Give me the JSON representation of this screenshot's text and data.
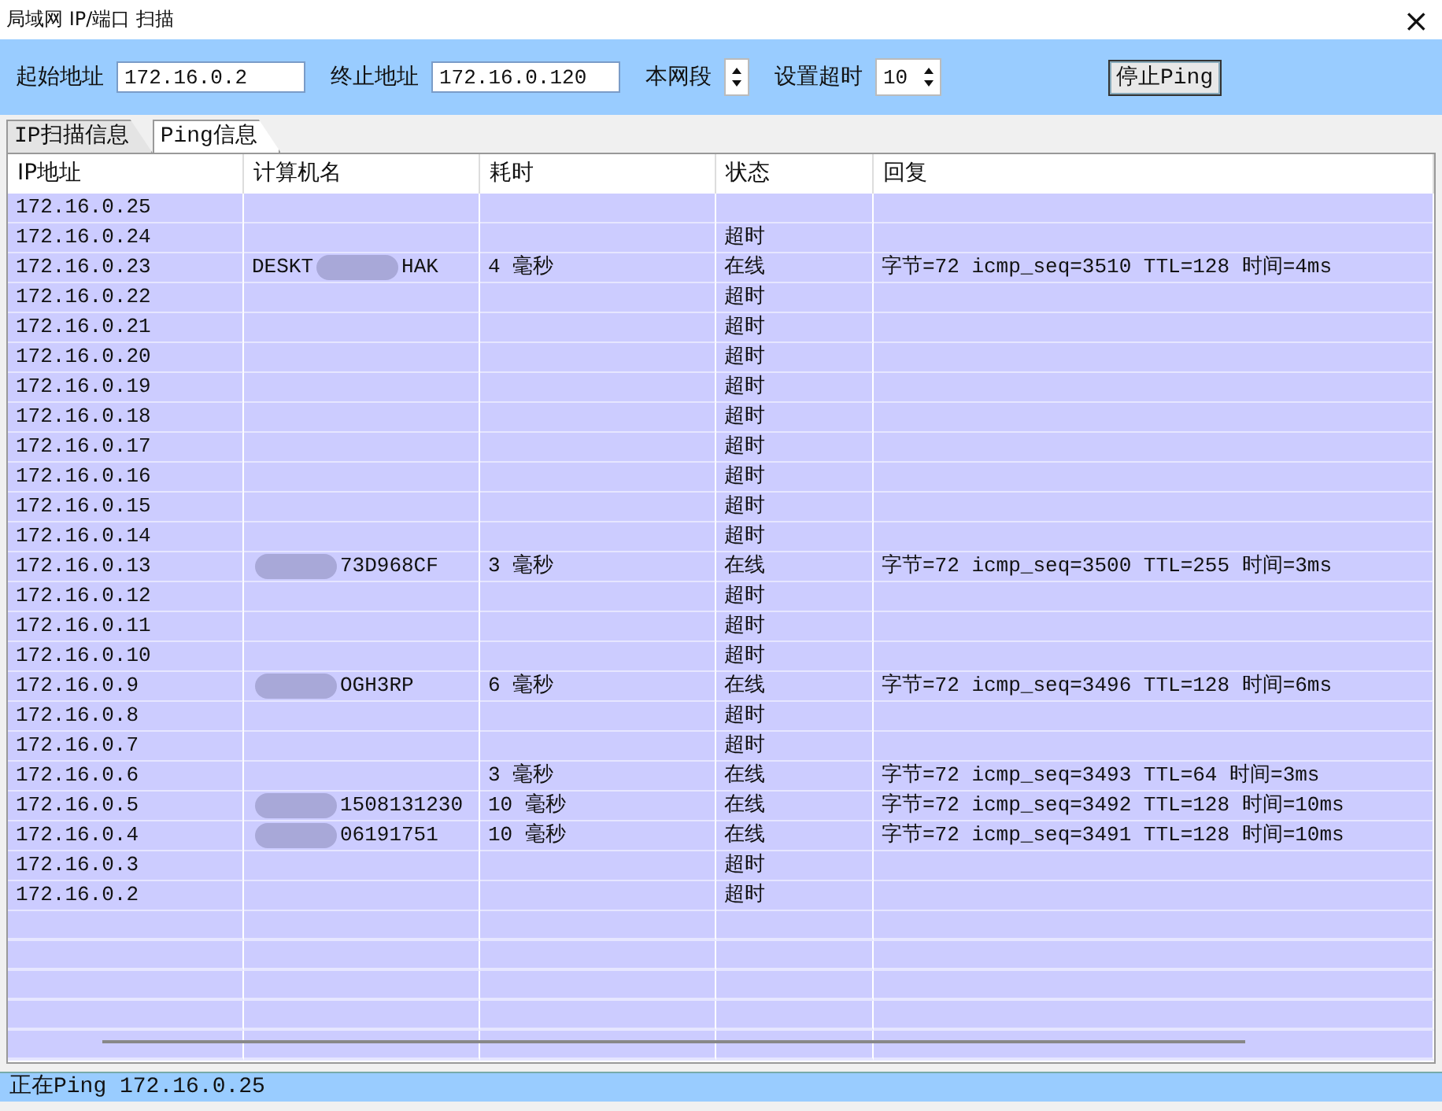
{
  "window": {
    "title": "局域网 IP/端口 扫描",
    "close": "×"
  },
  "toolbar": {
    "start_label": "起始地址",
    "start_value": "172.16.0.2",
    "end_label": "终止地址",
    "end_value": "172.16.0.120",
    "segment_label": "本网段",
    "timeout_label": "设置超时",
    "timeout_value": "10",
    "stop_button": "停止Ping"
  },
  "tabs": [
    {
      "label": "IP扫描信息",
      "selected": false
    },
    {
      "label": "Ping信息",
      "selected": true
    }
  ],
  "table": {
    "columns": [
      "IP地址",
      "计算机名",
      "耗时",
      "状态",
      "回复"
    ],
    "rows": [
      {
        "ip": "172.16.0.25",
        "name_hidden": false
      },
      {
        "ip": "172.16.0.24",
        "name_hidden": false,
        "status": "超时"
      },
      {
        "ip": "172.16.0.23",
        "name_hidden": true,
        "name_start": "DESKT",
        "name_end": "HAK",
        "time": "4 毫秒",
        "status": "在线",
        "reply": "字节=72 icmp_seq=3510 TTL=128 时间=4ms"
      },
      {
        "ip": "172.16.0.22",
        "name_hidden": false,
        "status": "超时"
      },
      {
        "ip": "172.16.0.21",
        "name_hidden": false,
        "status": "超时"
      },
      {
        "ip": "172.16.0.20",
        "name_hidden": false,
        "status": "超时"
      },
      {
        "ip": "172.16.0.19",
        "name_hidden": false,
        "status": "超时"
      },
      {
        "ip": "172.16.0.18",
        "name_hidden": false,
        "status": "超时"
      },
      {
        "ip": "172.16.0.17",
        "name_hidden": false,
        "status": "超时"
      },
      {
        "ip": "172.16.0.16",
        "name_hidden": false,
        "status": "超时"
      },
      {
        "ip": "172.16.0.15",
        "name_hidden": false,
        "status": "超时"
      },
      {
        "ip": "172.16.0.14",
        "name_hidden": false,
        "status": "超时"
      },
      {
        "ip": "172.16.0.13",
        "name_hidden": true,
        "name_end": "73D968CF",
        "time": "3 毫秒",
        "status": "在线",
        "reply": "字节=72 icmp_seq=3500 TTL=255 时间=3ms"
      },
      {
        "ip": "172.16.0.12",
        "name_hidden": false,
        "status": "超时"
      },
      {
        "ip": "172.16.0.11",
        "name_hidden": false,
        "status": "超时"
      },
      {
        "ip": "172.16.0.10",
        "name_hidden": false,
        "status": "超时"
      },
      {
        "ip": "172.16.0.9",
        "name_hidden": true,
        "name_end": "OGH3RP",
        "time": "6 毫秒",
        "status": "在线",
        "reply": "字节=72 icmp_seq=3496 TTL=128 时间=6ms"
      },
      {
        "ip": "172.16.0.8",
        "name_hidden": false,
        "status": "超时"
      },
      {
        "ip": "172.16.0.7",
        "name_hidden": false,
        "status": "超时"
      },
      {
        "ip": "172.16.0.6",
        "name_hidden": false,
        "time": "3 毫秒",
        "status": "在线",
        "reply": "字节=72 icmp_seq=3493 TTL=64 时间=3ms"
      },
      {
        "ip": "172.16.0.5",
        "name_hidden": true,
        "name_end": "1508131230",
        "time": "10 毫秒",
        "status": "在线",
        "reply": "字节=72 icmp_seq=3492 TTL=128 时间=10ms"
      },
      {
        "ip": "172.16.0.4",
        "name_hidden": true,
        "name_end": "06191751",
        "time": "10 毫秒",
        "status": "在线",
        "reply": "字节=72 icmp_seq=3491 TTL=128 时间=10ms"
      },
      {
        "ip": "172.16.0.3",
        "name_hidden": false,
        "status": "超时"
      },
      {
        "ip": "172.16.0.2",
        "name_hidden": false,
        "status": "超时"
      }
    ]
  },
  "status_bar": "正在Ping 172.16.0.25"
}
